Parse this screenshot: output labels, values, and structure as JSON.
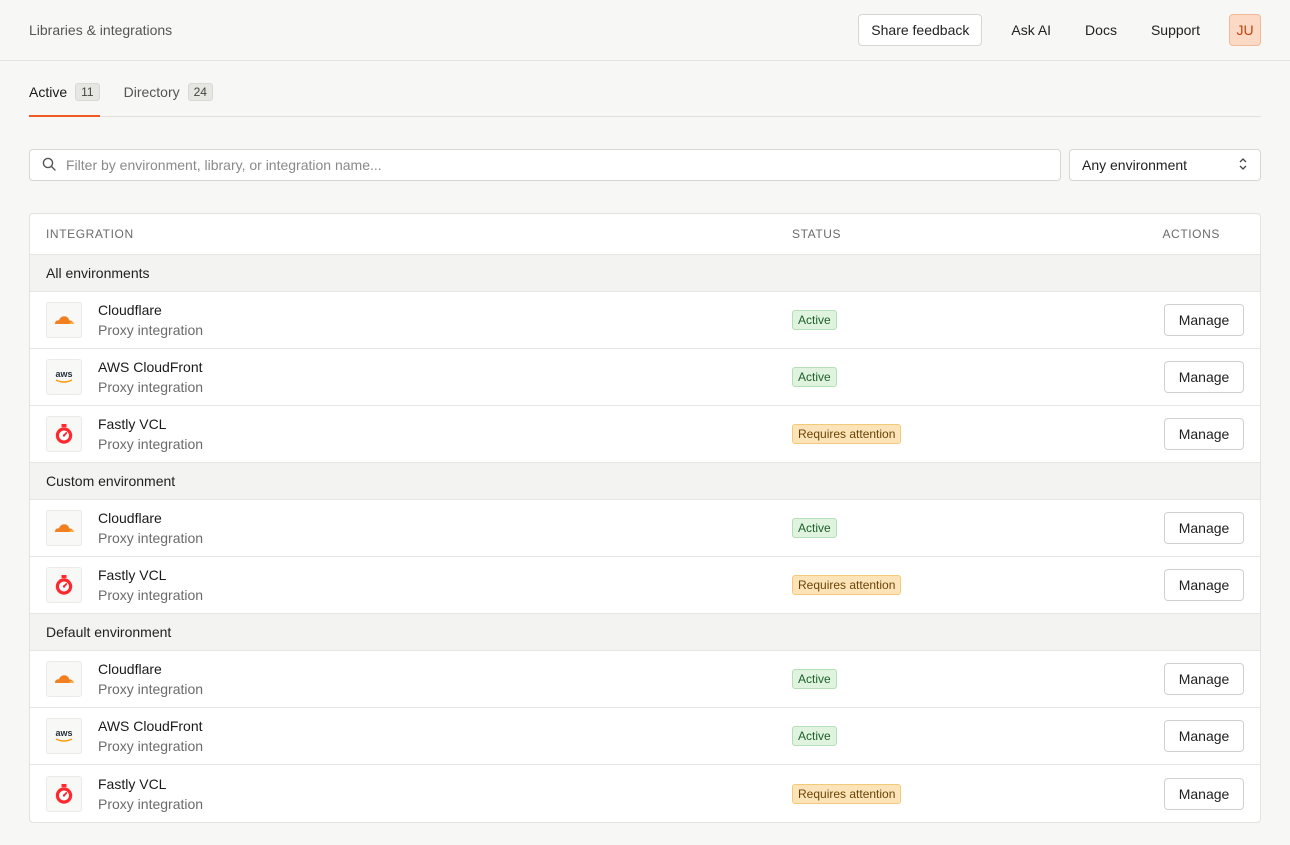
{
  "header": {
    "breadcrumb": "Libraries & integrations",
    "share_feedback": "Share feedback",
    "ask_ai": "Ask AI",
    "docs": "Docs",
    "support": "Support",
    "avatar_initials": "JU"
  },
  "tabs": [
    {
      "label": "Active",
      "count": "11"
    },
    {
      "label": "Directory",
      "count": "24"
    }
  ],
  "filters": {
    "search_placeholder": "Filter by environment, library, or integration name...",
    "environment_select": "Any environment"
  },
  "table": {
    "columns": {
      "integration": "INTEGRATION",
      "status": "STATUS",
      "actions": "ACTIONS"
    },
    "groups": [
      {
        "name": "All environments",
        "rows": [
          {
            "name": "Cloudflare",
            "type": "Proxy integration",
            "logo": "cloudflare-icon",
            "status": "Active",
            "action": "Manage"
          },
          {
            "name": "AWS CloudFront",
            "type": "Proxy integration",
            "logo": "aws-icon",
            "status": "Active",
            "action": "Manage"
          },
          {
            "name": "Fastly VCL",
            "type": "Proxy integration",
            "logo": "fastly-icon",
            "status": "Requires attention",
            "action": "Manage"
          }
        ]
      },
      {
        "name": "Custom environment",
        "rows": [
          {
            "name": "Cloudflare",
            "type": "Proxy integration",
            "logo": "cloudflare-icon",
            "status": "Active",
            "action": "Manage"
          },
          {
            "name": "Fastly VCL",
            "type": "Proxy integration",
            "logo": "fastly-icon",
            "status": "Requires attention",
            "action": "Manage"
          }
        ]
      },
      {
        "name": "Default environment",
        "rows": [
          {
            "name": "Cloudflare",
            "type": "Proxy integration",
            "logo": "cloudflare-icon",
            "status": "Active",
            "action": "Manage"
          },
          {
            "name": "AWS CloudFront",
            "type": "Proxy integration",
            "logo": "aws-icon",
            "status": "Active",
            "action": "Manage"
          },
          {
            "name": "Fastly VCL",
            "type": "Proxy integration",
            "logo": "fastly-icon",
            "status": "Requires attention",
            "action": "Manage"
          }
        ]
      }
    ]
  },
  "logos": {
    "aws_text": "aws"
  },
  "colors": {
    "accent": "#f15a24",
    "active_badge_bg": "#dff3df",
    "attention_badge_bg": "#fde4b8",
    "cloudflare_orange": "#f38020",
    "fastly_red": "#ff282d"
  }
}
